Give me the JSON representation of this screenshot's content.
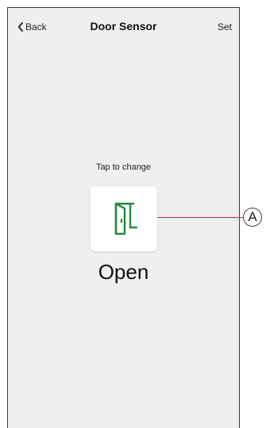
{
  "nav": {
    "back_label": "Back",
    "title": "Door Sensor",
    "set_label": "Set"
  },
  "content": {
    "hint": "Tap to change",
    "state_label": "Open",
    "state_icon": "door-open-icon"
  },
  "annotation": {
    "label": "A"
  },
  "colors": {
    "accent_green": "#1e8a3c",
    "callout_line": "#b2334f",
    "screen_bg": "#efefef"
  }
}
